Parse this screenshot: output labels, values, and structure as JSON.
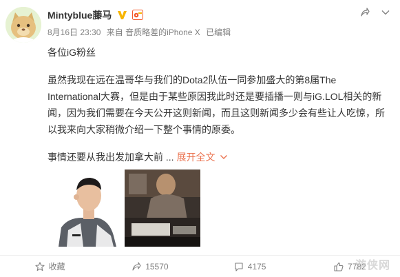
{
  "user": {
    "name": "Mintyblue藤马"
  },
  "meta": {
    "date_time": "8月16日 23:30",
    "source": "来自 音质略差的iPhone X",
    "edited": "已编辑"
  },
  "post": {
    "greeting": "各位iG粉丝",
    "body": "虽然我现在远在温哥华与我们的Dota2队伍一同参加盛大的第8届The International大赛，但是由于某些原因我此时还是要插播一则与iG.LOL相关的新闻，因为我们需要在今天公开这则新闻，而且这则新闻多少会有些让人吃惊，所以我来向大家稍微介绍一下整个事情的原委。",
    "excerpt": "事情还要从我出发加拿大前 ...",
    "expand_label": "展开全文"
  },
  "actions": {
    "favorite": "收藏",
    "repost": "15570",
    "comment": "4175",
    "like": "7782"
  },
  "watermark": "游侠网",
  "colors": {
    "accent": "#eb7350",
    "meta": "#808080",
    "verified": "#f7b500"
  },
  "icons": {
    "verified": "verified-v-icon",
    "member": "member-icon",
    "share": "share-icon",
    "more": "chevron-down-icon",
    "favorite": "star-icon",
    "repost": "repost-icon",
    "comment": "comment-icon",
    "like": "thumbs-up-icon"
  }
}
